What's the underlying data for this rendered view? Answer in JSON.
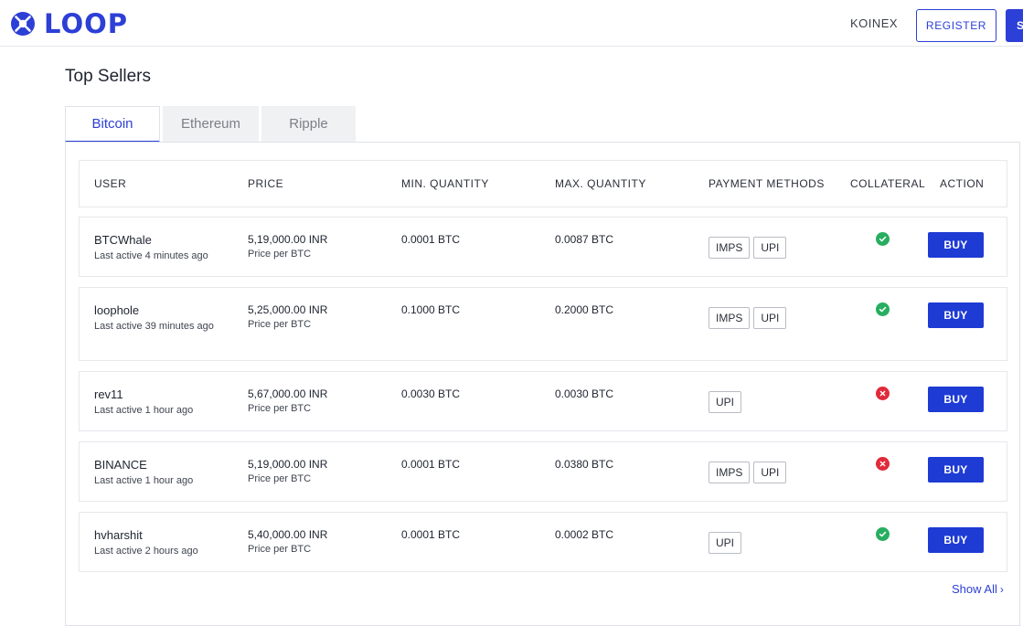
{
  "header": {
    "brand": "LOOP",
    "nav_link": "KOINEX",
    "register_label": "REGISTER",
    "signin_label": "S"
  },
  "page": {
    "title": "Top Sellers"
  },
  "tabs": [
    {
      "label": "Bitcoin",
      "active": true
    },
    {
      "label": "Ethereum",
      "active": false
    },
    {
      "label": "Ripple",
      "active": false
    }
  ],
  "table": {
    "columns": [
      "USER",
      "PRICE",
      "MIN. QUANTITY",
      "MAX. QUANTITY",
      "PAYMENT METHODS",
      "COLLATERAL",
      "ACTION"
    ],
    "rows": [
      {
        "user": "BTCWhale",
        "last_active": "Last active 4 minutes ago",
        "price": "5,19,000.00 INR",
        "price_sub": "Price per BTC",
        "min": "0.0001 BTC",
        "max": "0.0087 BTC",
        "methods": [
          "IMPS",
          "UPI"
        ],
        "collateral": "check-icon",
        "action": "BUY"
      },
      {
        "user": "loophole",
        "last_active": "Last active 39 minutes ago",
        "price": "5,25,000.00 INR",
        "price_sub": "Price per BTC",
        "min": "0.1000 BTC",
        "max": "0.2000 BTC",
        "methods": [
          "IMPS",
          "UPI"
        ],
        "collateral": "check-icon",
        "action": "BUY"
      },
      {
        "user": "rev11",
        "last_active": "Last active 1 hour ago",
        "price": "5,67,000.00 INR",
        "price_sub": "Price per BTC",
        "min": "0.0030 BTC",
        "max": "0.0030 BTC",
        "methods": [
          "UPI"
        ],
        "collateral": "cross-icon",
        "action": "BUY"
      },
      {
        "user": "BINANCE",
        "last_active": "Last active 1 hour ago",
        "price": "5,19,000.00 INR",
        "price_sub": "Price per BTC",
        "min": "0.0001 BTC",
        "max": "0.0380 BTC",
        "methods": [
          "IMPS",
          "UPI"
        ],
        "collateral": "cross-icon",
        "action": "BUY"
      },
      {
        "user": "hvharshit",
        "last_active": "Last active 2 hours ago",
        "price": "5,40,000.00 INR",
        "price_sub": "Price per BTC",
        "min": "0.0001 BTC",
        "max": "0.0002 BTC",
        "methods": [
          "UPI"
        ],
        "collateral": "check-icon",
        "action": "BUY"
      }
    ]
  },
  "footer": {
    "show_all": "Show All"
  },
  "colors": {
    "brand": "#2c3fd6",
    "button": "#1e3bd4",
    "ok": "#27ae60",
    "no": "#e02a3a"
  }
}
